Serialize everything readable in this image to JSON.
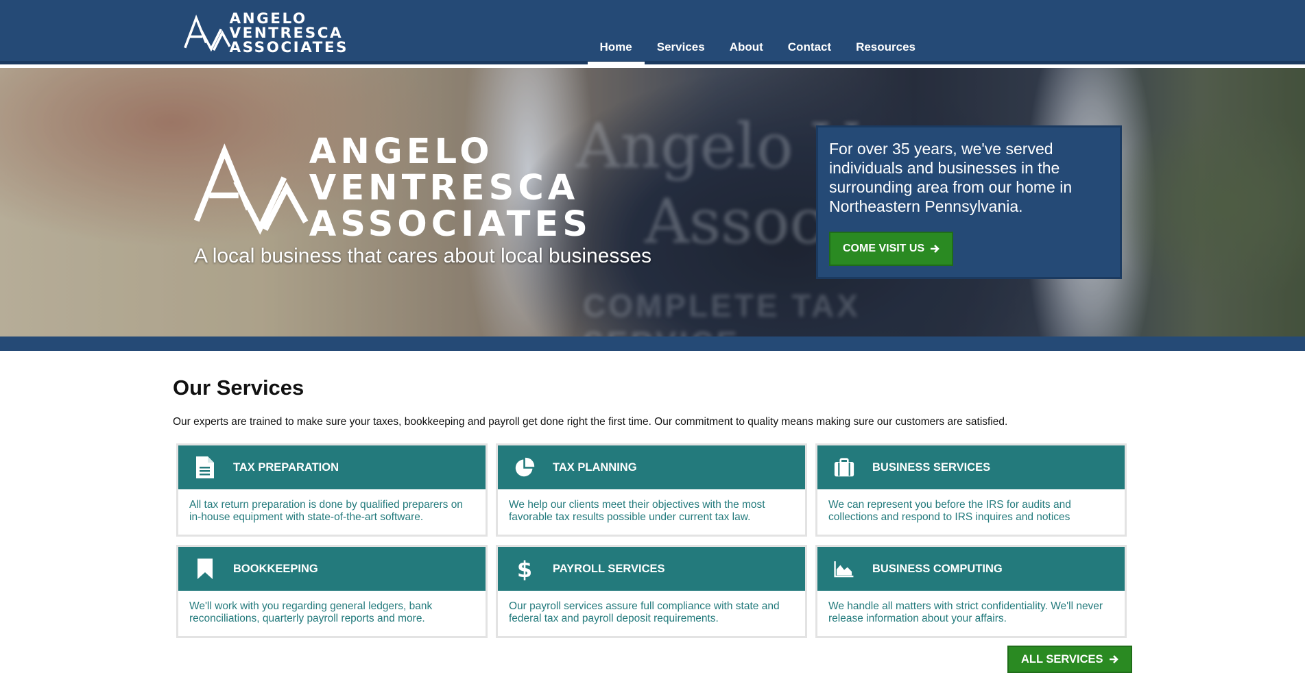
{
  "brand": {
    "name_lines": [
      "ANGELO",
      "VENTRESCA",
      "ASSOCIATES"
    ]
  },
  "nav": {
    "items": [
      {
        "label": "Home",
        "active": true
      },
      {
        "label": "Services",
        "active": false
      },
      {
        "label": "About",
        "active": false
      },
      {
        "label": "Contact",
        "active": false
      },
      {
        "label": "Resources",
        "active": false
      }
    ]
  },
  "hero": {
    "tagline": "A local business that cares about local businesses",
    "background_sign": {
      "line1": "Angelo Ve",
      "line2": "Assoc.",
      "line3": "COMPLETE TAX SERVICE"
    },
    "callout_text": "For over 35 years, we've served individuals and businesses in the surrounding area from our home in Northeastern Pennsylvania.",
    "visit_button": "COME VISIT US"
  },
  "services": {
    "title": "Our Services",
    "intro": "Our experts are trained to make sure your taxes, bookkeeping and payroll get done right the first time. Our commitment to quality means making sure our customers are satisfied.",
    "cards": [
      {
        "icon": "document-icon",
        "title": "TAX PREPARATION",
        "text": "All tax return preparation is done by qualified preparers on in-house equipment with state-of-the-art software."
      },
      {
        "icon": "pie-chart-icon",
        "title": "TAX PLANNING",
        "text": "We help our clients meet their objectives with the most favorable tax results possible under current tax law."
      },
      {
        "icon": "briefcase-icon",
        "title": "BUSINESS SERVICES",
        "text": "We can represent you before the IRS for audits and collections and respond to IRS inquires and notices"
      },
      {
        "icon": "bookmark-icon",
        "title": "BOOKKEEPING",
        "text": "We'll work with you regarding general ledgers, bank reconciliations, quarterly payroll reports and more."
      },
      {
        "icon": "dollar-icon",
        "title": "PAYROLL SERVICES",
        "text": "Our payroll services assure full compliance with state and federal tax and payroll deposit requirements."
      },
      {
        "icon": "area-chart-icon",
        "title": "BUSINESS COMPUTING",
        "text": "We handle all matters with strict confidentiality. We'll never release information about your affairs."
      }
    ],
    "all_button": "ALL SERVICES"
  },
  "colors": {
    "header_blue": "#254a76",
    "teal": "#237a7c",
    "green": "#2a8a22"
  }
}
